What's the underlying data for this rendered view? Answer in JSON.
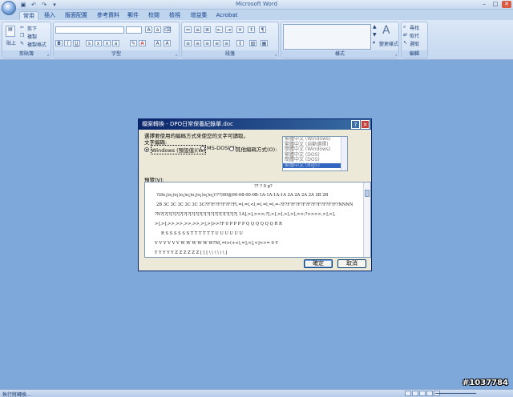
{
  "window": {
    "title": "Microsoft Word"
  },
  "tabs": [
    "常用",
    "插入",
    "版面配置",
    "參考資料",
    "郵件",
    "校閱",
    "檢視",
    "增益集",
    "Acrobat"
  ],
  "ribbon": {
    "groups": [
      "剪貼簿",
      "字型",
      "段落",
      "樣式",
      "編輯"
    ],
    "clipboard": {
      "paste": "貼上",
      "cut": "剪下",
      "copy": "複製",
      "format_painter": "複製格式"
    },
    "styles_btn": "變更樣式",
    "editing": {
      "find": "尋找",
      "replace": "取代",
      "select": "選取"
    }
  },
  "dialog": {
    "title": "檔案轉換 - DPO日常保養紀錄單.doc",
    "prompt": "選擇要使用的編碼方式來使您的文字可讀取。",
    "text_encoding_label": "文字編碼:",
    "radios": [
      "Windows (預設值)(W)",
      "MS-DOS(M)",
      "其他編碼方式(O):"
    ],
    "encodings": [
      "繁體中文 (Windows)",
      "繁體中文 (自動選擇)",
      "簡體中文 (Windows)",
      "繁體中文 (DOS)",
      "簡體中文 (DOS)",
      "繁體中文 (Big5)"
    ],
    "preview_label": "預覽(V):",
    "preview_lines": [
      "?? ? 0 g?",
      "?2fo¡)o¡)o¡)o¡)o¡)o¡)o¡)o¡)o¡)!??)00@00-08-00-0B-1A-1A-1A-1A 2A 2A 2A 2A 2B 2B",
      "2B 3C 3C 3C 3C 3C 3C?F?F?F?F?F?Fl,=l,=l,<l,=l,=l,=l,=-?F?F?F?F?F?F?F?F?F?F?F?NNNN",
      "?N?[?[?[?[?[?[?[?[?[?[?[?[?[?[?[?[?[?[?[?[ 1A],>],>>>;?],>],>],>],>],>>;?>>>>,>],>],",
      ">],>],>>,>>,>>,>>,>],>]>>?F   0   P   P   P   P   Q   Q   Q   Q   Q   Q   R   R",
      "R   S   S   S   S   S   S   T   T   T   T   T   T   U   U   U   U   U   U",
      "V   V   V   V   V   V   W   W   W   W   W   W?N(,=l+(+<),=],<],<]<>=   0   Y",
      "Y   Y   Y   Y   Y   Z   Z   Z   Z   Z   Z   [   [   [   \\   \\   \\   \\   \\   \\   ]"
    ],
    "ok": "確定",
    "cancel": "取消"
  },
  "status": {
    "text": "執行將轉換..."
  },
  "watermark": "#1037784"
}
